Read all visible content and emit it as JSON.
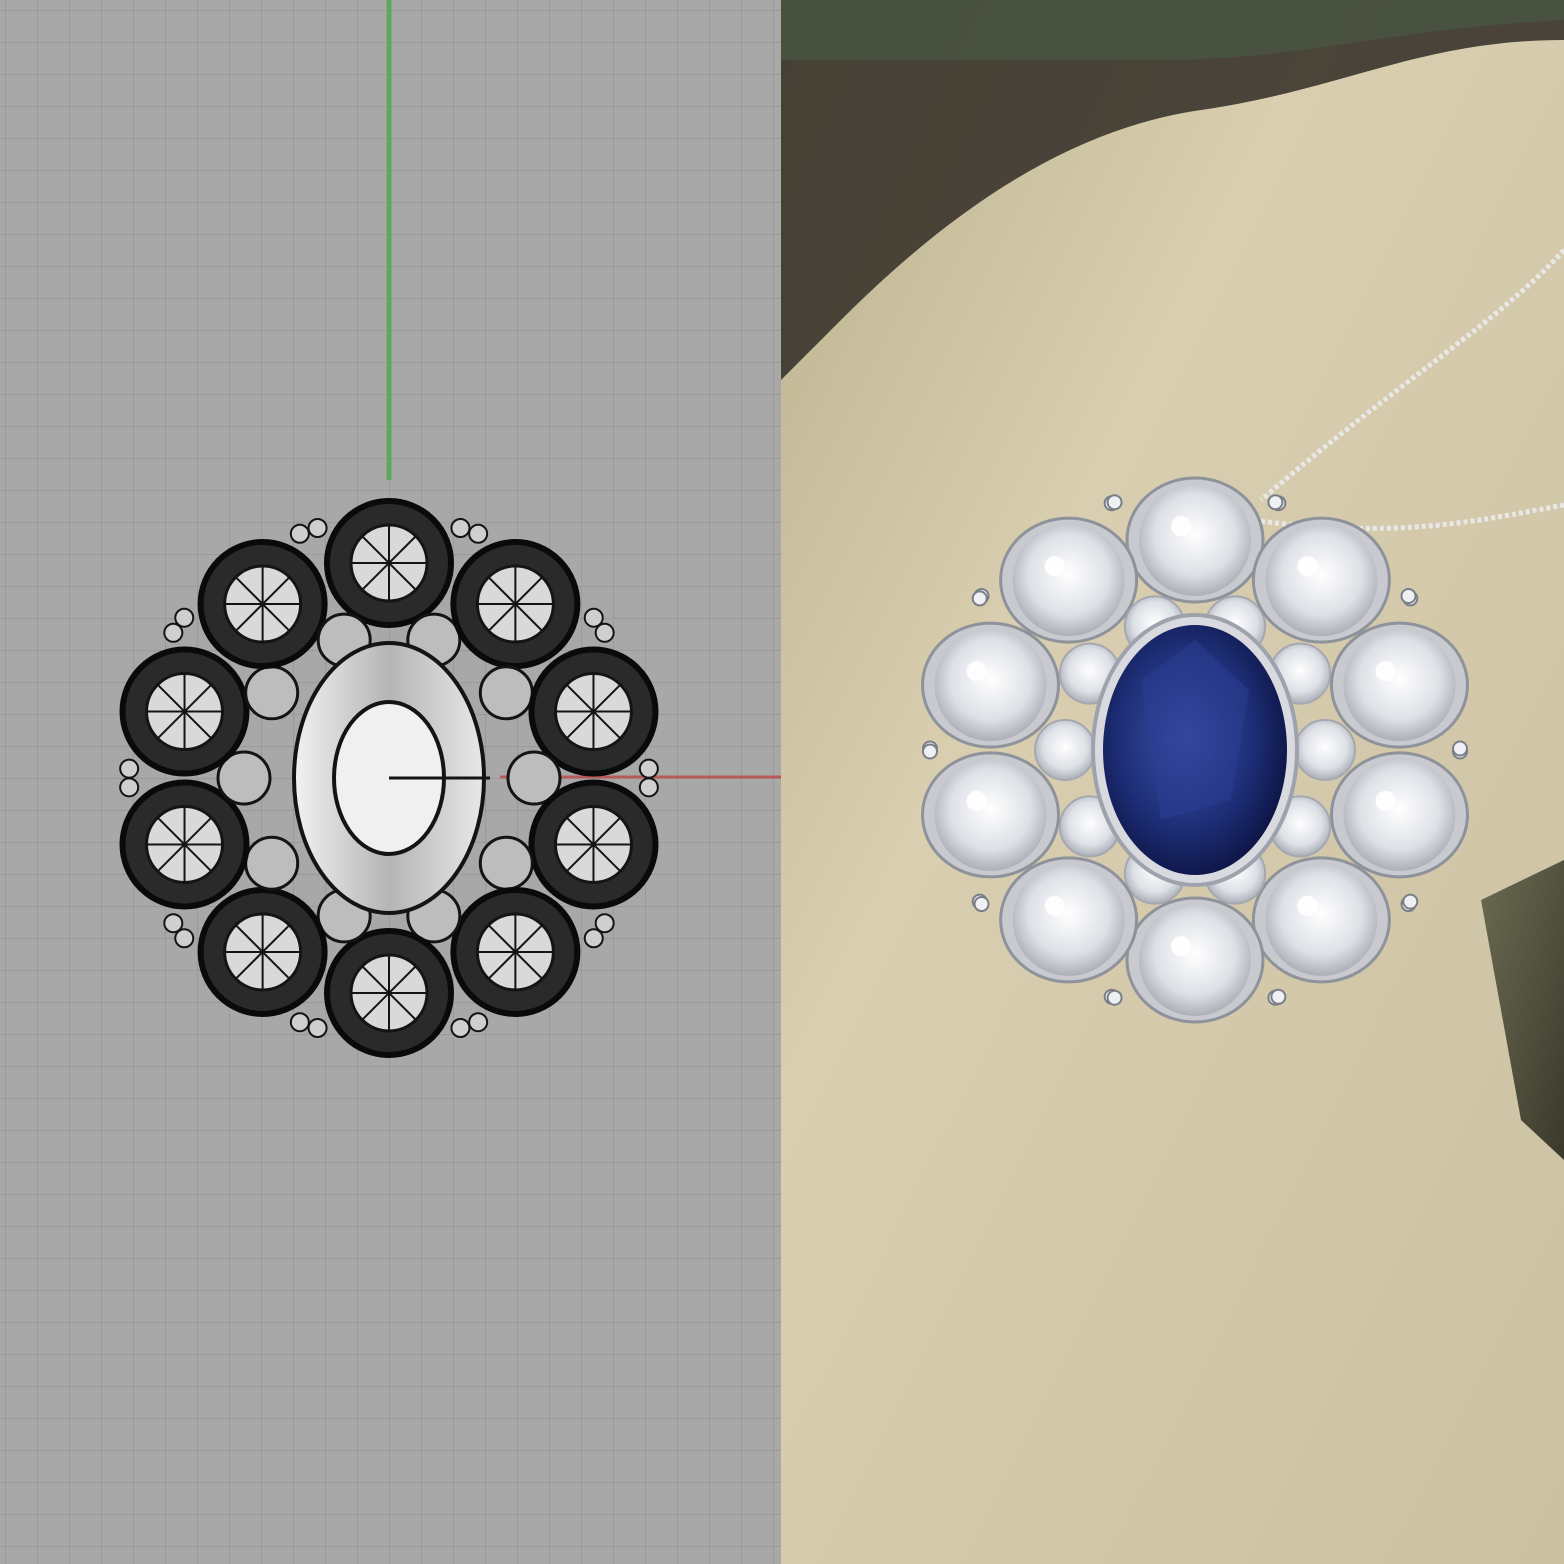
{
  "composite": {
    "left_panel": {
      "kind": "cad-viewport-render",
      "subject": "flower-cluster-pendant-wireframe",
      "colors": {
        "grid_background": "#a8a8a8",
        "grid_line": "#969696",
        "y_axis": "#5ea85e",
        "x_axis": "#b85a5a",
        "wireframe": "#141414",
        "center_setting": "#cfcfcf"
      },
      "petal_count": 10
    },
    "right_panel": {
      "kind": "product-photo",
      "subject": "pendant-with-blue-oval-center-stone-and-diamond-halo",
      "colors": {
        "background_light": "#d9cfb0",
        "background_dark": "#3a342c",
        "center_stone": "#1e2f78",
        "diamond": "#e8eaee",
        "metal": "#c8cad0",
        "tweezers": "#4a4a38"
      },
      "petal_count": 10
    }
  }
}
